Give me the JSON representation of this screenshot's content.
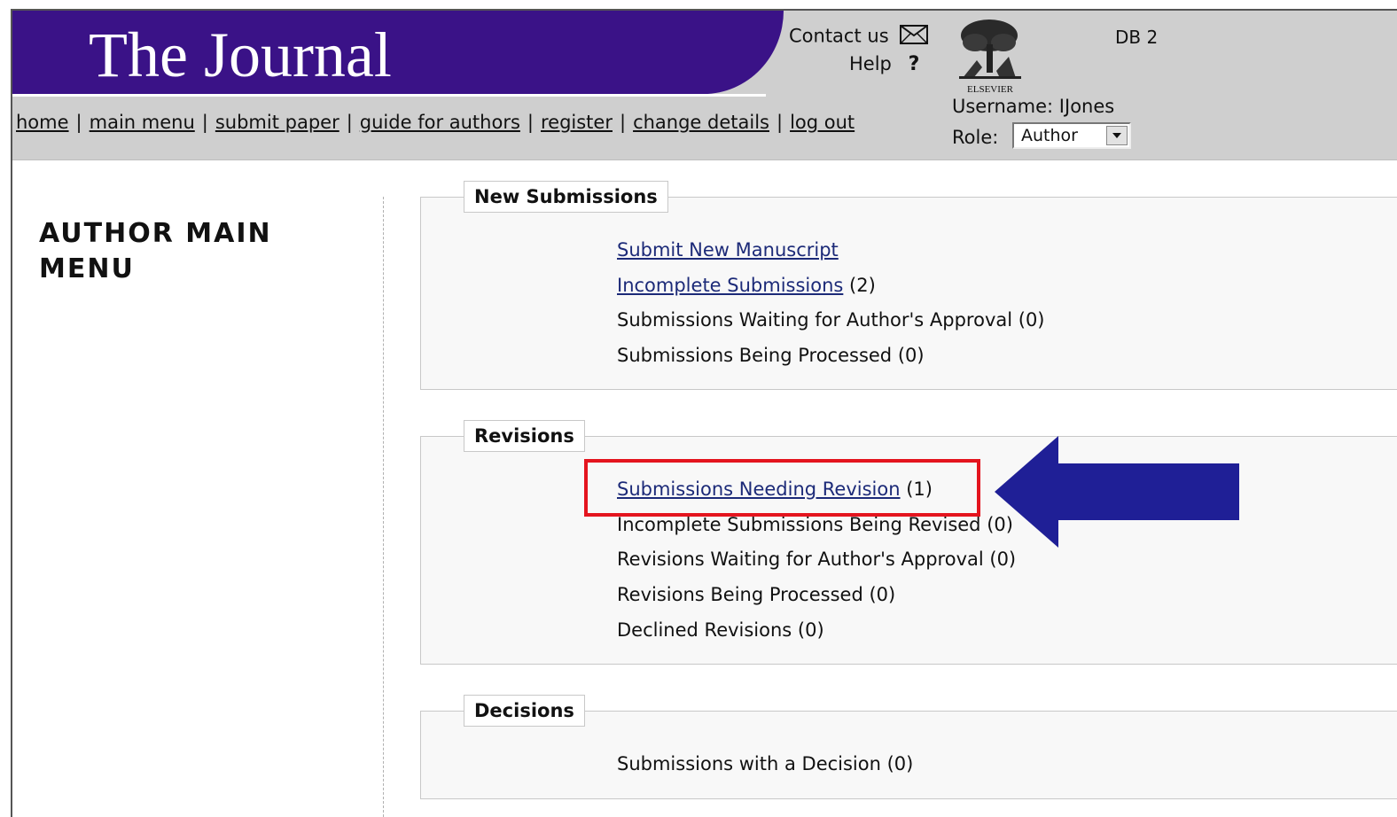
{
  "header": {
    "journal_title": "The Journal",
    "contact_label": "Contact us",
    "help_label": "Help",
    "help_symbol": "?",
    "publisher": "ELSEVIER",
    "db_label": "DB 2",
    "username_text": "Username: IJones",
    "role_label": "Role:",
    "role_value": "Author",
    "colors": {
      "banner": "#3a1287",
      "header_bg": "#cfcfcf"
    }
  },
  "nav": {
    "items": [
      "home",
      "main menu",
      "submit paper",
      "guide for authors",
      "register",
      "change details",
      "log out"
    ],
    "separator": "|"
  },
  "page": {
    "title": "AUTHOR MAIN MENU"
  },
  "sections": {
    "new_submissions": {
      "legend": "New Submissions",
      "items": [
        {
          "label": "Submit New Manuscript",
          "count": "",
          "link": true
        },
        {
          "label": "Incomplete Submissions",
          "count": "(2)",
          "link": true
        },
        {
          "label": "Submissions Waiting for Author's Approval (0)",
          "count": "",
          "link": false
        },
        {
          "label": "Submissions Being Processed (0)",
          "count": "",
          "link": false
        }
      ]
    },
    "revisions": {
      "legend": "Revisions",
      "items": [
        {
          "label": "Submissions Needing Revision",
          "count": "(1)",
          "link": true
        },
        {
          "label": "Incomplete Submissions Being Revised (0)",
          "count": "",
          "link": false
        },
        {
          "label": "Revisions Waiting for Author's Approval (0)",
          "count": "",
          "link": false
        },
        {
          "label": "Revisions Being Processed (0)",
          "count": "",
          "link": false
        },
        {
          "label": "Declined Revisions (0)",
          "count": "",
          "link": false
        }
      ]
    },
    "decisions": {
      "legend": "Decisions",
      "items": [
        {
          "label": "Submissions with a Decision (0)",
          "count": "",
          "link": false
        }
      ]
    }
  },
  "annotation": {
    "highlight_color": "#e4141e",
    "arrow_color": "#1f1f96"
  }
}
